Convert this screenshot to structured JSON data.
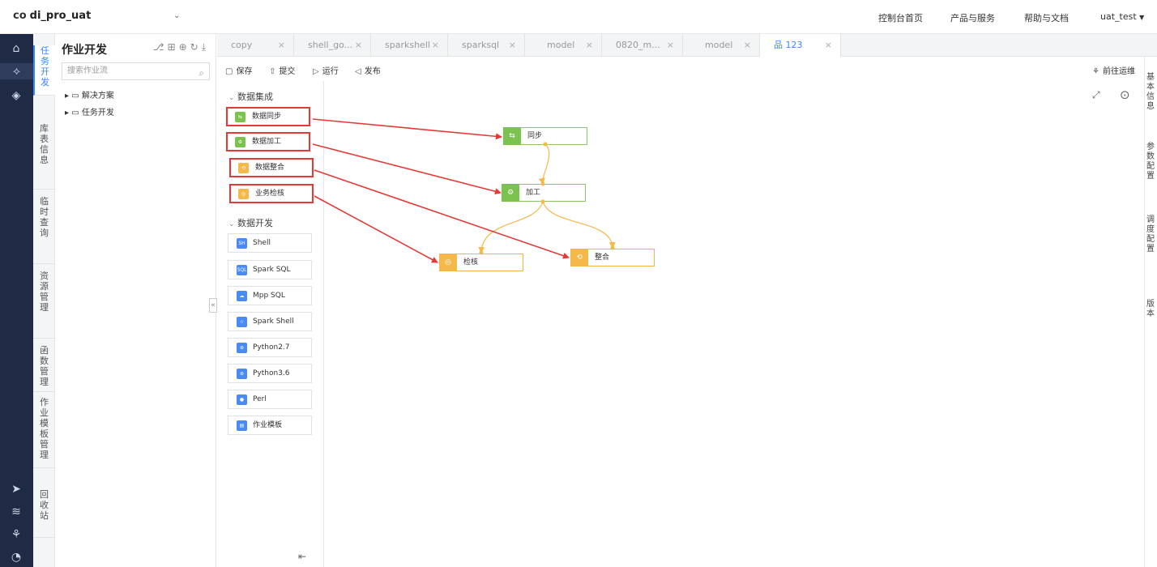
{
  "header": {
    "project_name": "di_pro_uat",
    "nav": [
      "控制台首页",
      "产品与服务",
      "帮助与文档"
    ],
    "user": "uat_test"
  },
  "vtabs": [
    "任务开发",
    "库表信息",
    "临时查询",
    "资源管理",
    "函数管理",
    "作业模板管理",
    "回收站"
  ],
  "tree": {
    "title": "作业开发",
    "search_placeholder": "搜索作业流",
    "items": [
      "解决方案",
      "任务开发"
    ]
  },
  "tabs": [
    "copy",
    "shell_go...",
    "sparkshell",
    "sparksql",
    "model",
    "0820_m...",
    "model",
    "123"
  ],
  "toolbar": {
    "save": "保存",
    "submit": "提交",
    "run": "运行",
    "publish": "发布",
    "goto_ops": "前往运维"
  },
  "palette": {
    "group1_title": "数据集成",
    "group1_items": [
      "数据同步",
      "数据加工",
      "数据整合",
      "业务检核"
    ],
    "group2_title": "数据开发",
    "group2_items": [
      "Shell",
      "Spark SQL",
      "Mpp SQL",
      "Spark Shell",
      "Python2.7",
      "Python3.6",
      "Perl",
      "作业模板"
    ]
  },
  "flow_nodes": [
    "同步",
    "加工",
    "检核",
    "整合"
  ],
  "right_panel": [
    "基本信息",
    "参数配置",
    "调度配置",
    "版本"
  ],
  "colors": {
    "accent": "#3a86ff",
    "highlight": "#e53935",
    "green": "#7bc24e",
    "orange": "#f5b94a"
  }
}
